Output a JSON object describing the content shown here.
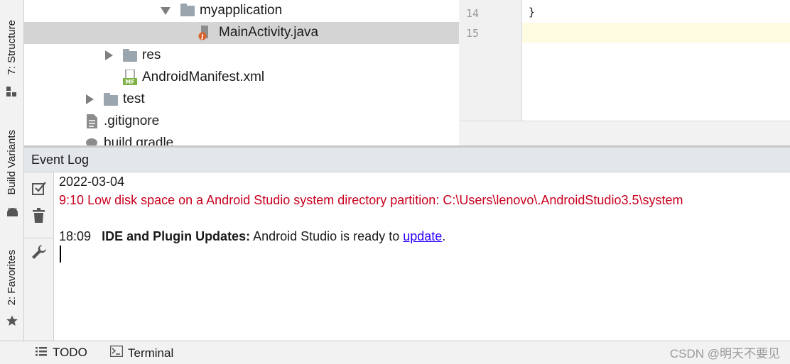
{
  "left_stripe": {
    "structure_label": "7: Structure",
    "build_variants_label": "Build Variants",
    "favorites_label": "2: Favorites"
  },
  "tree": [
    {
      "label": "myapplication",
      "type": "folder",
      "expanded": true
    },
    {
      "label": "MainActivity.java",
      "type": "java-file",
      "selected": true
    },
    {
      "label": "res",
      "type": "folder",
      "expanded": false
    },
    {
      "label": "AndroidManifest.xml",
      "type": "manifest-file"
    },
    {
      "label": "test",
      "type": "folder",
      "expanded": false
    },
    {
      "label": ".gitignore",
      "type": "text-file"
    },
    {
      "label": "build.gradle",
      "type": "gradle-file"
    }
  ],
  "editor": {
    "lines": [
      {
        "num": "14",
        "code": "}"
      },
      {
        "num": "15",
        "code": ""
      }
    ]
  },
  "event_log": {
    "title": "Event Log",
    "date": "2022-03-04",
    "error_time": "9:10",
    "error_msg": "Low disk space on a Android Studio system directory partition: C:\\Users\\lenovo\\.AndroidStudio3.5\\system",
    "update_time": "18:09",
    "update_title": "IDE and Plugin Updates:",
    "update_msg": "Android Studio is ready to",
    "update_link": "update",
    "update_period": "."
  },
  "bottom_bar": {
    "todo_label": "TODO",
    "terminal_label": "Terminal",
    "watermark": "CSDN @明天不要见"
  },
  "colors": {
    "error": "#c8001e",
    "link": "#2a00ff",
    "selection": "#d4d4d4",
    "current_line": "#fffbe0"
  }
}
